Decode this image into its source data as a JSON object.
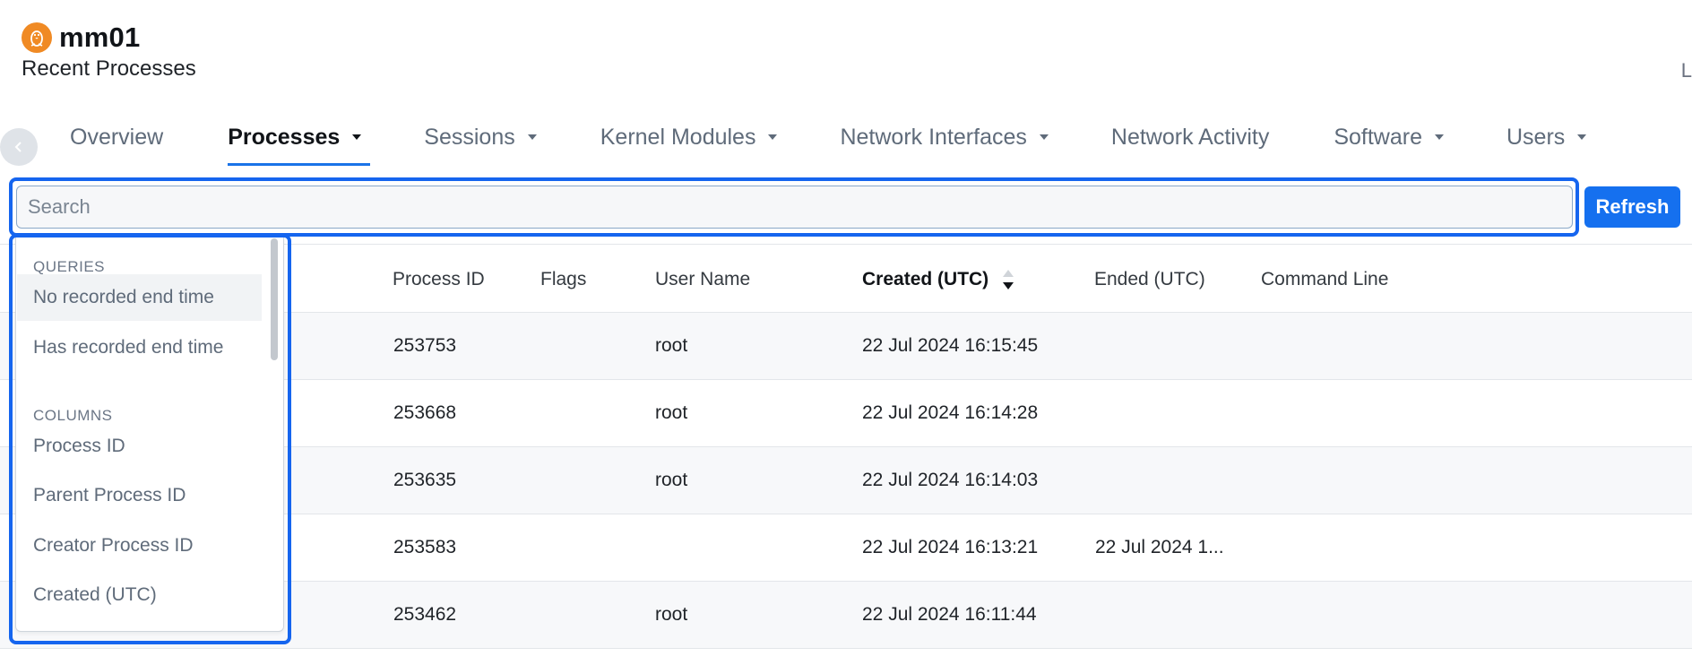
{
  "header": {
    "host_name": "mm01",
    "subtitle": "Recent Processes",
    "clipped_text": "L"
  },
  "tabs": [
    {
      "label": "Overview",
      "has_menu": false,
      "active": false
    },
    {
      "label": "Processes",
      "has_menu": true,
      "active": true
    },
    {
      "label": "Sessions",
      "has_menu": true,
      "active": false
    },
    {
      "label": "Kernel Modules",
      "has_menu": true,
      "active": false
    },
    {
      "label": "Network Interfaces",
      "has_menu": true,
      "active": false
    },
    {
      "label": "Network Activity",
      "has_menu": false,
      "active": false
    },
    {
      "label": "Software",
      "has_menu": true,
      "active": false
    },
    {
      "label": "Users",
      "has_menu": true,
      "active": false
    }
  ],
  "search": {
    "placeholder": "Search",
    "value": "",
    "refresh_label": "Refresh"
  },
  "dropdown": {
    "queries_heading": "QUERIES",
    "queries": [
      "No recorded end time",
      "Has recorded end time"
    ],
    "columns_heading": "COLUMNS",
    "columns": [
      "Process ID",
      "Parent Process ID",
      "Creator Process ID",
      "Created (UTC)"
    ]
  },
  "table": {
    "headers": [
      "Process ID",
      "Flags",
      "User Name",
      "Created (UTC)",
      "Ended (UTC)",
      "Command Line"
    ],
    "sorted_column": "Created (UTC)",
    "sort_direction": "descending",
    "rows": [
      {
        "pid": "253753",
        "flags": "",
        "user": "root",
        "created": "22 Jul 2024 16:15:45",
        "ended": "",
        "cmd": ""
      },
      {
        "pid": "253668",
        "flags": "",
        "user": "root",
        "created": "22 Jul 2024 16:14:28",
        "ended": "",
        "cmd": ""
      },
      {
        "pid": "253635",
        "flags": "",
        "user": "root",
        "created": "22 Jul 2024 16:14:03",
        "ended": "",
        "cmd": ""
      },
      {
        "pid": "253583",
        "flags": "",
        "user": "",
        "created": "22 Jul 2024 16:13:21",
        "ended": "22 Jul 2024 1...",
        "cmd": ""
      },
      {
        "pid": "253462",
        "flags": "",
        "user": "root",
        "created": "22 Jul 2024 16:11:44",
        "ended": "",
        "cmd": ""
      }
    ]
  },
  "colors": {
    "accent": "#1570ef",
    "highlight_frame": "#1565ef",
    "logo": "#f08a24"
  },
  "icons": {
    "logo": "linux-tux-icon",
    "back": "chevron-left-icon",
    "menu": "caret-down-icon",
    "sort": "sort-arrows-icon"
  }
}
